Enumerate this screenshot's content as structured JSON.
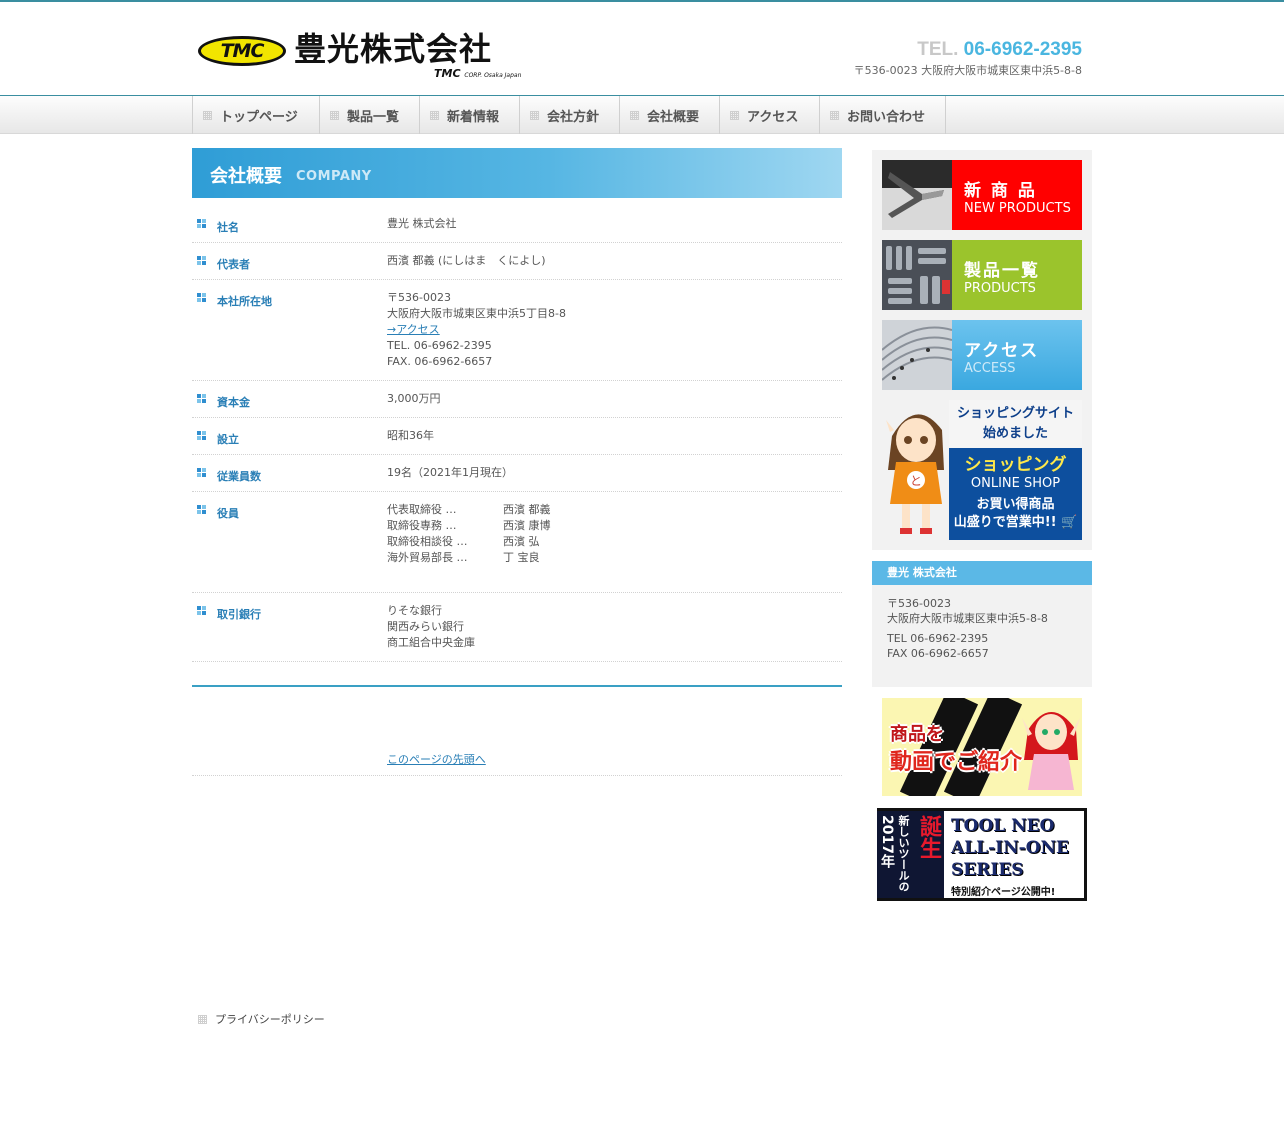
{
  "header": {
    "logo_mark": "TMC",
    "logo_name": "豊光株式会社",
    "logo_sub_mark": "TMC",
    "logo_sub_text": "CORP.  Osaka Japan",
    "tel_label": "TEL.",
    "tel_number": "06-6962-2395",
    "address": "〒536-0023 大阪府大阪市城東区東中浜5-8-8"
  },
  "nav": {
    "items": [
      {
        "label": "トップページ"
      },
      {
        "label": "製品一覧"
      },
      {
        "label": "新着情報"
      },
      {
        "label": "会社方針"
      },
      {
        "label": "会社概要"
      },
      {
        "label": "アクセス"
      },
      {
        "label": "お問い合わせ"
      }
    ]
  },
  "main": {
    "title_ja": "会社概要",
    "title_en": "COMPANY",
    "rows": {
      "name": {
        "key": "社名",
        "value": "豊光 株式会社"
      },
      "rep": {
        "key": "代表者",
        "value": "西濱 都義 (にしはま　くによし)"
      },
      "hq": {
        "key": "本社所在地",
        "postal": "〒536-0023",
        "address": "大阪府大阪市城東区東中浜5丁目8-8",
        "access_link": "→アクセス",
        "tel": "TEL. 06-6962-2395",
        "fax": "FAX. 06-6962-6657"
      },
      "capital": {
        "key": "資本金",
        "value": "3,000万円"
      },
      "founded": {
        "key": "設立",
        "value": "昭和36年"
      },
      "employees": {
        "key": "従業員数",
        "value": "19名（2021年1月現在）"
      },
      "officers": {
        "key": "役員",
        "list": [
          {
            "role": "代表取締役 …",
            "name": "西濱 都義"
          },
          {
            "role": "取締役専務 …",
            "name": "西濱 康博"
          },
          {
            "role": "取締役相談役 …",
            "name": "西濱 弘"
          },
          {
            "role": "海外貿易部長 …",
            "name": "丁 宝良"
          }
        ]
      },
      "banks": {
        "key": "取引銀行",
        "list": [
          "りそな銀行",
          "関西みらい銀行",
          "商工組合中央金庫"
        ]
      }
    },
    "page_top": "このページの先頭へ"
  },
  "sidebar": {
    "banners": [
      {
        "ja": "新 商 品",
        "en": "NEW PRODUCTS",
        "color": "#ff0000"
      },
      {
        "ja": "製品一覧",
        "en": "PRODUCTS",
        "color": "#9bc42c"
      },
      {
        "ja": "アクセス",
        "en": "ACCESS",
        "color": "#55b3e4"
      }
    ],
    "shop": {
      "line1": "ショッピングサイト",
      "line2": "始めました",
      "title": "ショッピング",
      "en": "ONLINE SHOP",
      "promo1": "お買い得商品",
      "promo2": "山盛りで営業中!!"
    },
    "company": {
      "name": "豊光 株式会社",
      "postal": "〒536-0023",
      "address": "大阪府大阪市城東区東中浜5-8-8",
      "tel": "TEL 06-6962-2395",
      "fax": "FAX 06-6962-6657"
    },
    "video_banner": {
      "line1": "商品を",
      "line2": "動画でご紹介"
    },
    "tool_banner": {
      "year": "2017年",
      "sub": "新しいツールの",
      "big": "誕生",
      "title1": "TOOL NEO",
      "title2": "ALL-IN-ONE",
      "title3": "SERIES",
      "note": "特別紹介ページ公開中!"
    }
  },
  "footer": {
    "privacy": "プライバシーポリシー"
  }
}
